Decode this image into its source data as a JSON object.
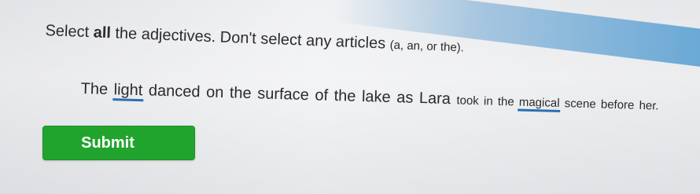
{
  "instruction": {
    "part1": "Select ",
    "bold": "all",
    "part2": " the adjectives. Don't select any articles ",
    "articles": "(a, an, or the)."
  },
  "sentence": {
    "words_main": [
      {
        "text": "The",
        "selected": false
      },
      {
        "text": "light",
        "selected": true
      },
      {
        "text": "danced",
        "selected": false
      },
      {
        "text": "on",
        "selected": false
      },
      {
        "text": "the",
        "selected": false
      },
      {
        "text": "surface",
        "selected": false
      },
      {
        "text": "of",
        "selected": false
      },
      {
        "text": "the",
        "selected": false
      },
      {
        "text": "lake",
        "selected": false
      },
      {
        "text": "as",
        "selected": false
      },
      {
        "text": "Lara",
        "selected": false
      }
    ],
    "words_tail": [
      {
        "text": "took",
        "selected": false
      },
      {
        "text": "in",
        "selected": false
      },
      {
        "text": "the",
        "selected": false
      },
      {
        "text": "magical",
        "selected": true
      },
      {
        "text": "scene",
        "selected": false
      },
      {
        "text": "before",
        "selected": false
      },
      {
        "text": "her.",
        "selected": false
      }
    ]
  },
  "submit": {
    "label": "Submit",
    "color": "#21a42e"
  },
  "selection_color": "#2b6fb5"
}
